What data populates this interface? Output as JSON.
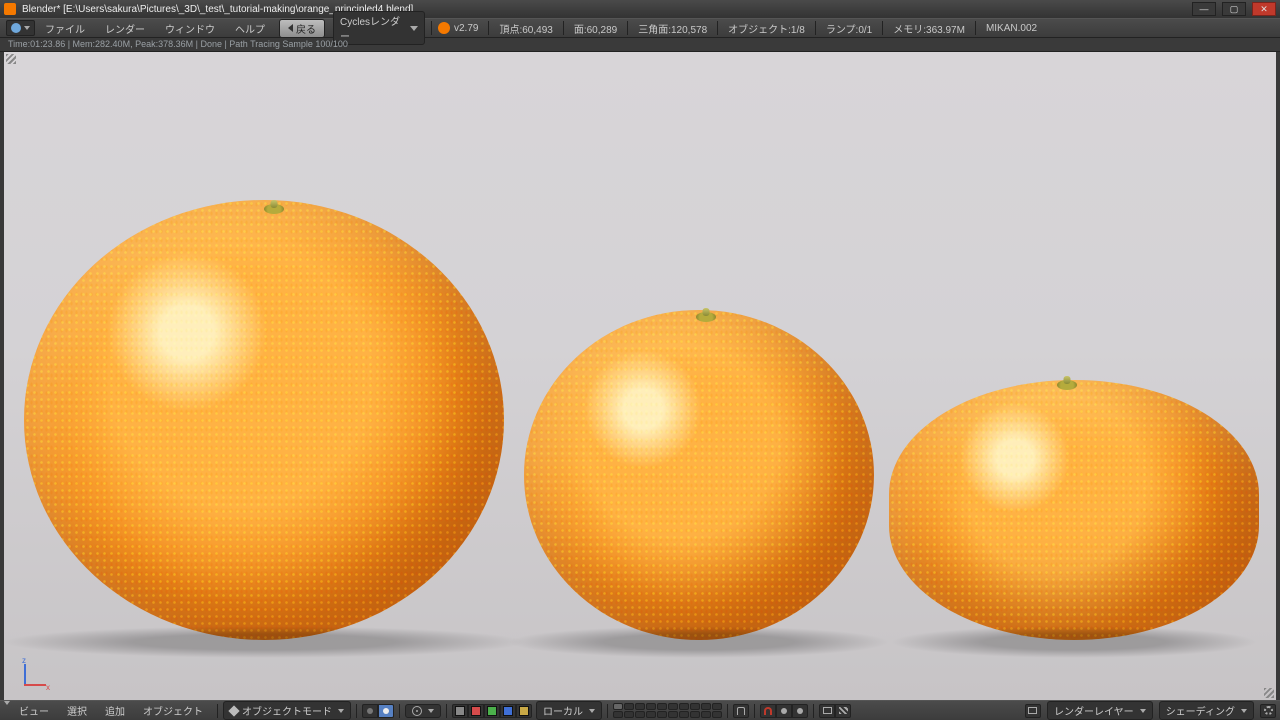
{
  "window": {
    "title": "Blender* [E:\\Users\\sakura\\Pictures\\_3D\\_test\\_tutorial-making\\orange_principled4.blend]",
    "min": "—",
    "max": "▢",
    "close": "✕"
  },
  "topmenu": {
    "items": [
      "ファイル",
      "レンダー",
      "ウィンドウ",
      "ヘルプ"
    ],
    "back": "戻る",
    "engine": "Cyclesレンダー",
    "version": "v2.79",
    "stats": {
      "verts": "頂点:60,493",
      "faces": "面:60,289",
      "tris": "三角面:120,578",
      "objects": "オブジェクト:1/8",
      "lamps": "ランプ:0/1",
      "mem": "メモリ:363.97M",
      "obj": "MIKAN.002"
    }
  },
  "renderstatus": "Time:01:23.86 | Mem:282.40M, Peak:378.36M | Done | Path Tracing Sample 100/100",
  "axes": {
    "z": "z",
    "x": "x"
  },
  "bottom": {
    "menus": [
      "ビュー",
      "選択",
      "追加",
      "オブジェクト"
    ],
    "mode": "オブジェクトモード",
    "orient": "ローカル",
    "layer_label": "レンダーレイヤー",
    "shade_label": "シェーディング"
  }
}
